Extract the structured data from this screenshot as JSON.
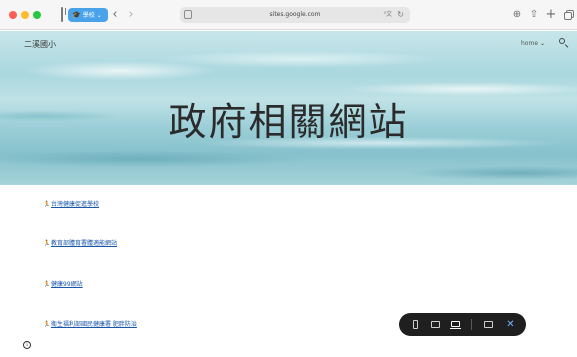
{
  "browser": {
    "tab_group_label": "學校",
    "address_url": "sites.google.com",
    "translate_label": "⁰文",
    "back_glyph": "‹",
    "forward_glyph": "›",
    "download_glyph": "⊕",
    "share_glyph": "⇧",
    "newtab_glyph": "+"
  },
  "site": {
    "name": "二溪國小",
    "nav_home": "home",
    "hero_title": "政府相關網站"
  },
  "links": [
    {
      "label": "台灣健康促進學校"
    },
    {
      "label": "教育部體育署體適能網站"
    },
    {
      "label": "健康99網站"
    },
    {
      "label": "衛生福利部國民健康署 肥胖防治"
    }
  ],
  "preview_toolbar": {
    "close_glyph": "✕"
  },
  "colors": {
    "link": "#1a56a8",
    "tab_group": "#4aa3ea",
    "toolbar_bg": "#1f1f1f",
    "close_accent": "#6fb3ff"
  }
}
